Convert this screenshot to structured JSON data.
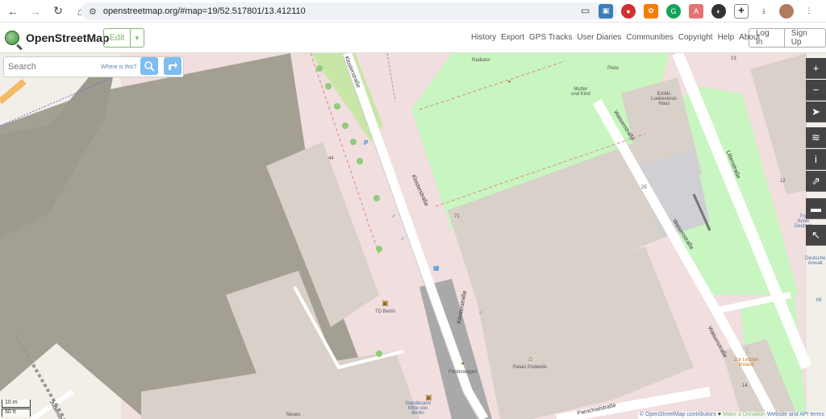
{
  "browser": {
    "url": "openstreetmap.org/#map=19/52.517801/13.412110"
  },
  "header": {
    "logo_text": "OpenStreetMap",
    "edit_label": "Edit",
    "nav_links": [
      "History",
      "Export",
      "GPS Tracks",
      "User Diaries",
      "Communities",
      "Copyright",
      "Help",
      "About"
    ],
    "login_label": "Log In",
    "signup_label": "Sign Up"
  },
  "search": {
    "placeholder": "Search",
    "where_label": "Where is this?"
  },
  "map": {
    "labels": {
      "radiator": "Radiator",
      "mutter": "Mutter\nund Kind",
      "pieta": "Pieta",
      "emmi": "EmMi-\nLuebeskind-\nHaus",
      "td_berlin": "TD Berlin",
      "palais": "Palais Podewils",
      "zur_letzten": "Zur Letzten\nInstanz",
      "forderwagen": "Förderwagen",
      "standesamt": "Standesamt\nMitte von\nBerlin",
      "neues": "Neues",
      "tsch": "Trsl\nSchw\nDeutsch",
      "deutsche_anw": "Deutsche\nAnwalt",
      "mi": "Mi"
    },
    "numbers": {
      "n13": "13",
      "n12": "12",
      "n44": "44",
      "n25": "25",
      "n71": "71",
      "n14": "14"
    },
    "streets": {
      "kloster_top": "Klosterstraße",
      "kloster_mid": "Klosterstraße",
      "kloster_bottom": "Klosterstraße",
      "waisen_top": "Waisenstraße",
      "waisen_mid": "Waisenstraße",
      "waisen_bottom": "Waisenstraße",
      "littenstrasse": "Littenstraße",
      "parochial": "Parochialstraße",
      "juden": "Jüdenstr"
    }
  },
  "scale": {
    "metric": "10 m",
    "imperial": "50 ft"
  },
  "attribution": {
    "osm": "© OpenStreetMap contributors",
    "heart": "♥",
    "donate": "Make a Donation",
    "terms": "Website and API terms"
  },
  "colors": {
    "osm_green": "#7ebc6f",
    "map_bg": "#f2efe9",
    "building": "#d9d0c9",
    "pink_area": "#f1dede",
    "park": "#c8f0b8",
    "control_dark": "#444444"
  }
}
